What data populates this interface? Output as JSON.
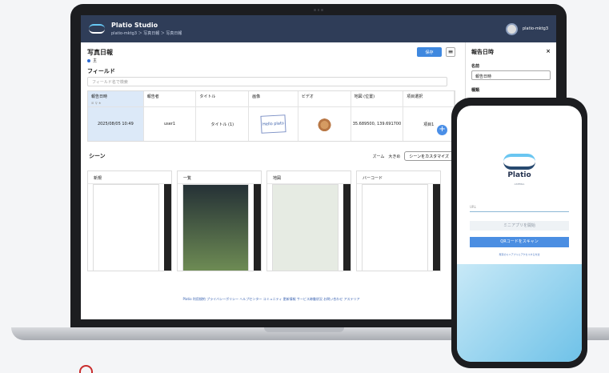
{
  "app": {
    "title": "Platio Studio",
    "breadcrumb": "platio-mktg3 ＞ 写真日報 ＞ 写真日報",
    "user": "platio-mktg3"
  },
  "page": {
    "title": "写真日報",
    "status": "主",
    "save": "保存",
    "menu": "≡"
  },
  "fields": {
    "title": "フィールド",
    "search_placeholder": "フィールド名で検索",
    "columns": [
      "報告日時",
      "報告者",
      "タイトル",
      "画像",
      "ビデオ",
      "地図 (位置)",
      "項目選択"
    ],
    "row": [
      "2025/08/05 10:49",
      "user1",
      "タイトル (1)",
      "Hello plato",
      "",
      "35.689500, 139.691700",
      "項目1"
    ]
  },
  "scenes": {
    "title": "シーン",
    "zoom_label": "ズーム",
    "zoom_value": "大きめ",
    "customize": "シーンをカスタマイズ",
    "cards": [
      "新規",
      "一覧",
      "地図",
      "バーコード"
    ]
  },
  "sidepanel": {
    "title": "報告日時",
    "name_label": "名前",
    "name_value": "報告日時",
    "type_label": "種類"
  },
  "footer": "Platio 利用規約  プライバシーポリシー  ヘルプセンター  コミュニティ  更新情報  サービス稼働状況  お問い合わせ  アステリア",
  "phone": {
    "brand": "Platio",
    "small": "ASTERIA",
    "url": "URL",
    "button1": "ミニアプリを開始",
    "button2": "QRコードをスキャン",
    "link": "既存のミニアプリにアクセスする方法"
  }
}
